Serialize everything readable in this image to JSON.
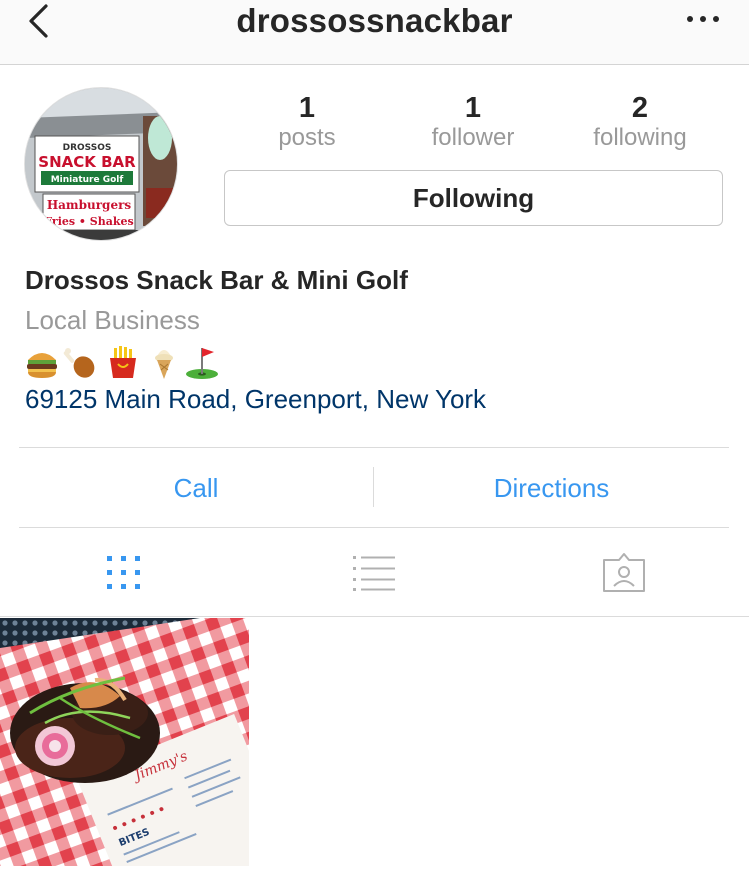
{
  "header": {
    "username": "drossossnackbar",
    "back_icon": "chevron-left-icon",
    "more_icon": "more-horizontal-icon"
  },
  "avatar": {
    "sign_lines": [
      "DROSSOS",
      "SNACK BAR",
      "Miniature Golf",
      "Hamburgers",
      "Fries • Shakes"
    ]
  },
  "stats": {
    "posts": {
      "count": "1",
      "label": "posts"
    },
    "followers": {
      "count": "1",
      "label": "follower"
    },
    "following": {
      "count": "2",
      "label": "following"
    }
  },
  "follow_button": {
    "label": "Following"
  },
  "bio": {
    "name": "Drossos Snack Bar & Mini Golf",
    "category": "Local Business",
    "emojis": [
      "hamburger-icon",
      "poultry-leg-icon",
      "french-fries-icon",
      "soft-ice-cream-icon",
      "golf-flag-icon"
    ],
    "address": "69125 Main Road, Greenport, New York"
  },
  "contact": {
    "call_label": "Call",
    "directions_label": "Directions"
  },
  "tabs": [
    {
      "name": "grid",
      "icon": "grid-icon",
      "active": true
    },
    {
      "name": "list",
      "icon": "list-icon",
      "active": false
    },
    {
      "name": "tagged",
      "icon": "tagged-person-icon",
      "active": false
    }
  ],
  "posts": [
    {
      "menu_heading": "BITES",
      "menu_brand": "Jimmy's"
    }
  ],
  "colors": {
    "link_blue": "#3897f0",
    "address_blue": "#003569",
    "muted_gray": "#999999",
    "text_dark": "#262626"
  }
}
